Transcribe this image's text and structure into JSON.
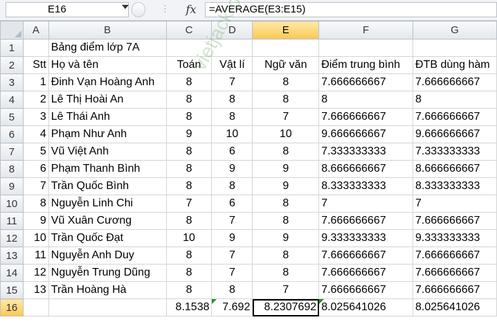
{
  "formula_bar": {
    "name_box": "E16",
    "fx_label": "fx",
    "formula": "=AVERAGE(E3:E15)"
  },
  "columns": [
    "A",
    "B",
    "C",
    "D",
    "E",
    "F",
    "G"
  ],
  "selected_column": "E",
  "rows": [
    {
      "n": "1",
      "cells": [
        "",
        "Bảng điểm lớp 7A",
        "",
        "",
        "",
        "",
        ""
      ]
    },
    {
      "n": "2",
      "cells": [
        "Stt",
        "Họ và tên",
        "Toán",
        "Vật lí",
        "Ngữ văn",
        "Điểm trung bình",
        "ĐTB dùng hàm"
      ]
    },
    {
      "n": "3",
      "cells": [
        "1",
        "Đinh Vạn Hoàng Anh",
        "8",
        "7",
        "8",
        "7.666666667",
        "7.666666667"
      ]
    },
    {
      "n": "4",
      "cells": [
        "2",
        "Lê Thị Hoài An",
        "8",
        "8",
        "8",
        "8",
        "8"
      ]
    },
    {
      "n": "5",
      "cells": [
        "3",
        "Lê Thái Anh",
        "8",
        "8",
        "7",
        "7.666666667",
        "7.666666667"
      ]
    },
    {
      "n": "6",
      "cells": [
        "4",
        "Phạm Như Anh",
        "9",
        "10",
        "10",
        "9.666666667",
        "9.666666667"
      ]
    },
    {
      "n": "7",
      "cells": [
        "5",
        "Vũ Việt Anh",
        "8",
        "6",
        "8",
        "7.333333333",
        "7.333333333"
      ]
    },
    {
      "n": "8",
      "cells": [
        "6",
        "Phạm Thanh Bình",
        "8",
        "9",
        "9",
        "8.666666667",
        "8.666666667"
      ]
    },
    {
      "n": "9",
      "cells": [
        "7",
        "Trần Quốc Bình",
        "8",
        "8",
        "9",
        "8.333333333",
        "8.333333333"
      ]
    },
    {
      "n": "10",
      "cells": [
        "8",
        "Nguyễn Linh Chi",
        "7",
        "6",
        "8",
        "7",
        "7"
      ]
    },
    {
      "n": "11",
      "cells": [
        "9",
        "Vũ Xuân Cương",
        "8",
        "7",
        "8",
        "7.666666667",
        "7.666666667"
      ]
    },
    {
      "n": "12",
      "cells": [
        "10",
        "Trần Quốc Đạt",
        "10",
        "9",
        "9",
        "9.333333333",
        "9.333333333"
      ]
    },
    {
      "n": "13",
      "cells": [
        "11",
        "Nguyễn Anh Duy",
        "8",
        "7",
        "8",
        "7.666666667",
        "7.666666667"
      ]
    },
    {
      "n": "14",
      "cells": [
        "12",
        "Nguyễn Trung Dũng",
        "8",
        "7",
        "8",
        "7.666666667",
        "7.666666667"
      ]
    },
    {
      "n": "15",
      "cells": [
        "13",
        "Trần Hoàng Hà",
        "8",
        "8",
        "7",
        "7.666666667",
        "7.666666667"
      ]
    },
    {
      "n": "16",
      "cells": [
        "",
        "",
        "8.1538",
        "7.692",
        "8.2307692",
        "8.025641026",
        "8.025641026"
      ]
    }
  ],
  "watermark": "vietjack oh khoa info",
  "colors": {
    "selection_header": "#f9c953",
    "error_triangle": "#2e8b2e"
  }
}
